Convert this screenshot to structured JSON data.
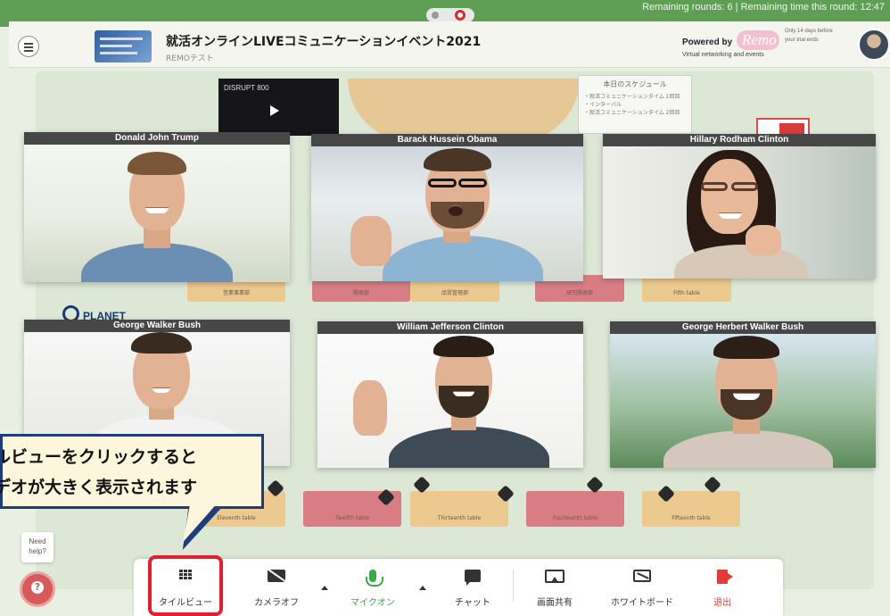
{
  "status_bar": {
    "rounds_text": "Remaining rounds: 6 | Remaining time this round: 12:47"
  },
  "header": {
    "event_title": "就活オンラインLIVEコミュニケーションイベント2021",
    "event_subtitle": "REMOテスト",
    "powered_by": "Powered by",
    "brand": "Remo",
    "tagline": "Virtual networking and events",
    "banner_note": "Only 14 days before your trial ends"
  },
  "floor": {
    "video_title": "DISRUPT 800",
    "schedule_title": "本日のスケジュール",
    "schedule_items": [
      "・就活コミュニケーションタイム 1回目",
      "・インターバル",
      "・就活コミュニケーションタイム 2回目"
    ],
    "sponsor_logo": "PLANET",
    "table_labels_row1": [
      "営業事業部",
      "開発部",
      "品質管理部",
      "研究開発部",
      "Fifth table"
    ],
    "table_labels_row2": [
      "Eleventh table",
      "Twelfth table",
      "Thirteenth table",
      "Fourteenth table",
      "Fifteenth table"
    ]
  },
  "tiles": [
    {
      "name": "Donald John Trump"
    },
    {
      "name": "Barack Hussein Obama"
    },
    {
      "name": "Hillary Rodham Clinton"
    },
    {
      "name": "George Walker Bush"
    },
    {
      "name": "William Jefferson Clinton"
    },
    {
      "name": "George Herbert Walker Bush"
    }
  ],
  "tooltip": {
    "line1": "ルビューをクリックすると",
    "line2": "デオが大きく表示されます"
  },
  "help": {
    "label_line1": "Need",
    "label_line2": "help?",
    "button_glyph": "?"
  },
  "toolbar": {
    "tile_view": "タイルビュー",
    "camera_off": "カメラオフ",
    "mic_on": "マイクオン",
    "chat": "チャット",
    "screen_share": "画面共有",
    "whiteboard": "ホワイトボード",
    "leave": "退出"
  },
  "colors": {
    "top_bar": "#5f9e55",
    "highlight_frame": "#e5202e",
    "mic_active": "#39a845",
    "leave": "#e33a3a",
    "tooltip_border": "#1f3d7a"
  }
}
